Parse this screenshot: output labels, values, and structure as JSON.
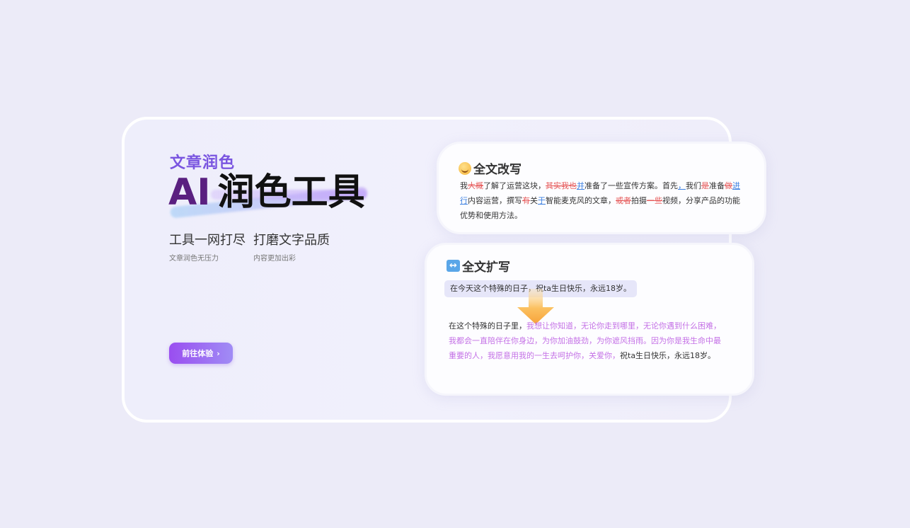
{
  "hero": {
    "subtitle": "文章润色",
    "title_ai": "AI",
    "title_main": "润色工具"
  },
  "features": [
    {
      "title": "工具一网打尽",
      "desc": "文章润色无压力"
    },
    {
      "title": "打磨文字品质",
      "desc": "内容更加出彩"
    }
  ],
  "cta": {
    "label": "前往体验",
    "chevron": "›"
  },
  "rewrite_panel": {
    "icon": "smiling-face-icon",
    "title": "全文改写",
    "segments": [
      {
        "type": "normal",
        "text": "我"
      },
      {
        "type": "del",
        "text": "大概"
      },
      {
        "type": "normal",
        "text": "了解了运营这块，"
      },
      {
        "type": "del",
        "text": "其实我也"
      },
      {
        "type": "add",
        "text": "并"
      },
      {
        "type": "normal",
        "text": "准备了一些宣传方案。首先"
      },
      {
        "type": "add",
        "text": "，"
      },
      {
        "type": "normal",
        "text": "我们"
      },
      {
        "type": "del",
        "text": "是"
      },
      {
        "type": "normal",
        "text": "准备"
      },
      {
        "type": "del",
        "text": "做"
      },
      {
        "type": "add",
        "text": "进行"
      },
      {
        "type": "normal",
        "text": "内容运营，撰写"
      },
      {
        "type": "del",
        "text": "有"
      },
      {
        "type": "normal",
        "text": "关"
      },
      {
        "type": "add",
        "text": "于"
      },
      {
        "type": "normal",
        "text": "智能麦克风的文章，"
      },
      {
        "type": "del",
        "text": "或者"
      },
      {
        "type": "normal",
        "text": "拍摄"
      },
      {
        "type": "del",
        "text": "一些"
      },
      {
        "type": "normal",
        "text": "视频，分享产品的功能优势和使用方法。"
      }
    ]
  },
  "expand_panel": {
    "icon": "left-right-arrow-icon",
    "title": "全文扩写",
    "source_text": "在今天这个特殊的日子，祝ta生日快乐，永远18岁。",
    "result_prefix": "在这个特殊的日子里，",
    "result_highlight": "我想让你知道，无论你走到哪里，无论你遇到什么困难，我都会一直陪伴在你身边，为你加油鼓劲，为你遮风挡雨。因为你是我生命中最重要的人，我愿意用我的一生去呵护你，关爱你，",
    "result_suffix": "祝ta生日快乐，永远18岁。"
  },
  "colors": {
    "accent_purple": "#7a55e0",
    "title_ai": "#5a2080",
    "deleted": "#e65a5a",
    "inserted": "#3a7ee0",
    "expanded": "#c471e6",
    "arrow": "#f8b04a"
  }
}
